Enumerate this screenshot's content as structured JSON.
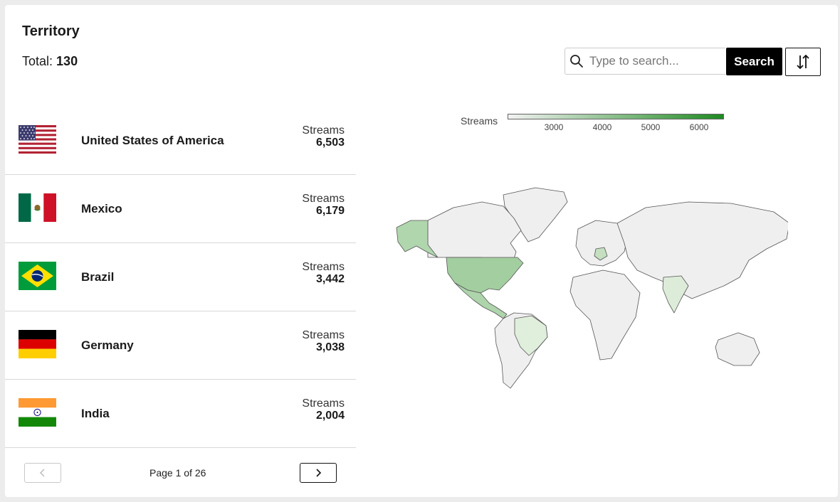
{
  "header": {
    "title": "Territory",
    "total_label": "Total:",
    "total_value": "130"
  },
  "search": {
    "placeholder": "Type to search...",
    "button_label": "Search"
  },
  "territories": [
    {
      "country": "United States of America",
      "streams_label": "Streams",
      "streams": "6,503",
      "flag": "us-flag-icon"
    },
    {
      "country": "Mexico",
      "streams_label": "Streams",
      "streams": "6,179",
      "flag": "mexico-flag-icon"
    },
    {
      "country": "Brazil",
      "streams_label": "Streams",
      "streams": "3,442",
      "flag": "brazil-flag-icon"
    },
    {
      "country": "Germany",
      "streams_label": "Streams",
      "streams": "3,038",
      "flag": "germany-flag-icon"
    },
    {
      "country": "India",
      "streams_label": "Streams",
      "streams": "2,004",
      "flag": "india-flag-icon"
    }
  ],
  "pagination": {
    "label": "Page 1 of 26",
    "current": 1,
    "total": 26
  },
  "map_legend": {
    "label": "Streams",
    "ticks": [
      "3000",
      "4000",
      "5000",
      "6000"
    ],
    "color_min": "#f2f2f2",
    "color_max": "#1f8a22"
  },
  "icons": {
    "search": "search-icon",
    "sort": "sort-arrows-icon",
    "prev": "chevron-left-icon",
    "next": "chevron-right-icon"
  }
}
